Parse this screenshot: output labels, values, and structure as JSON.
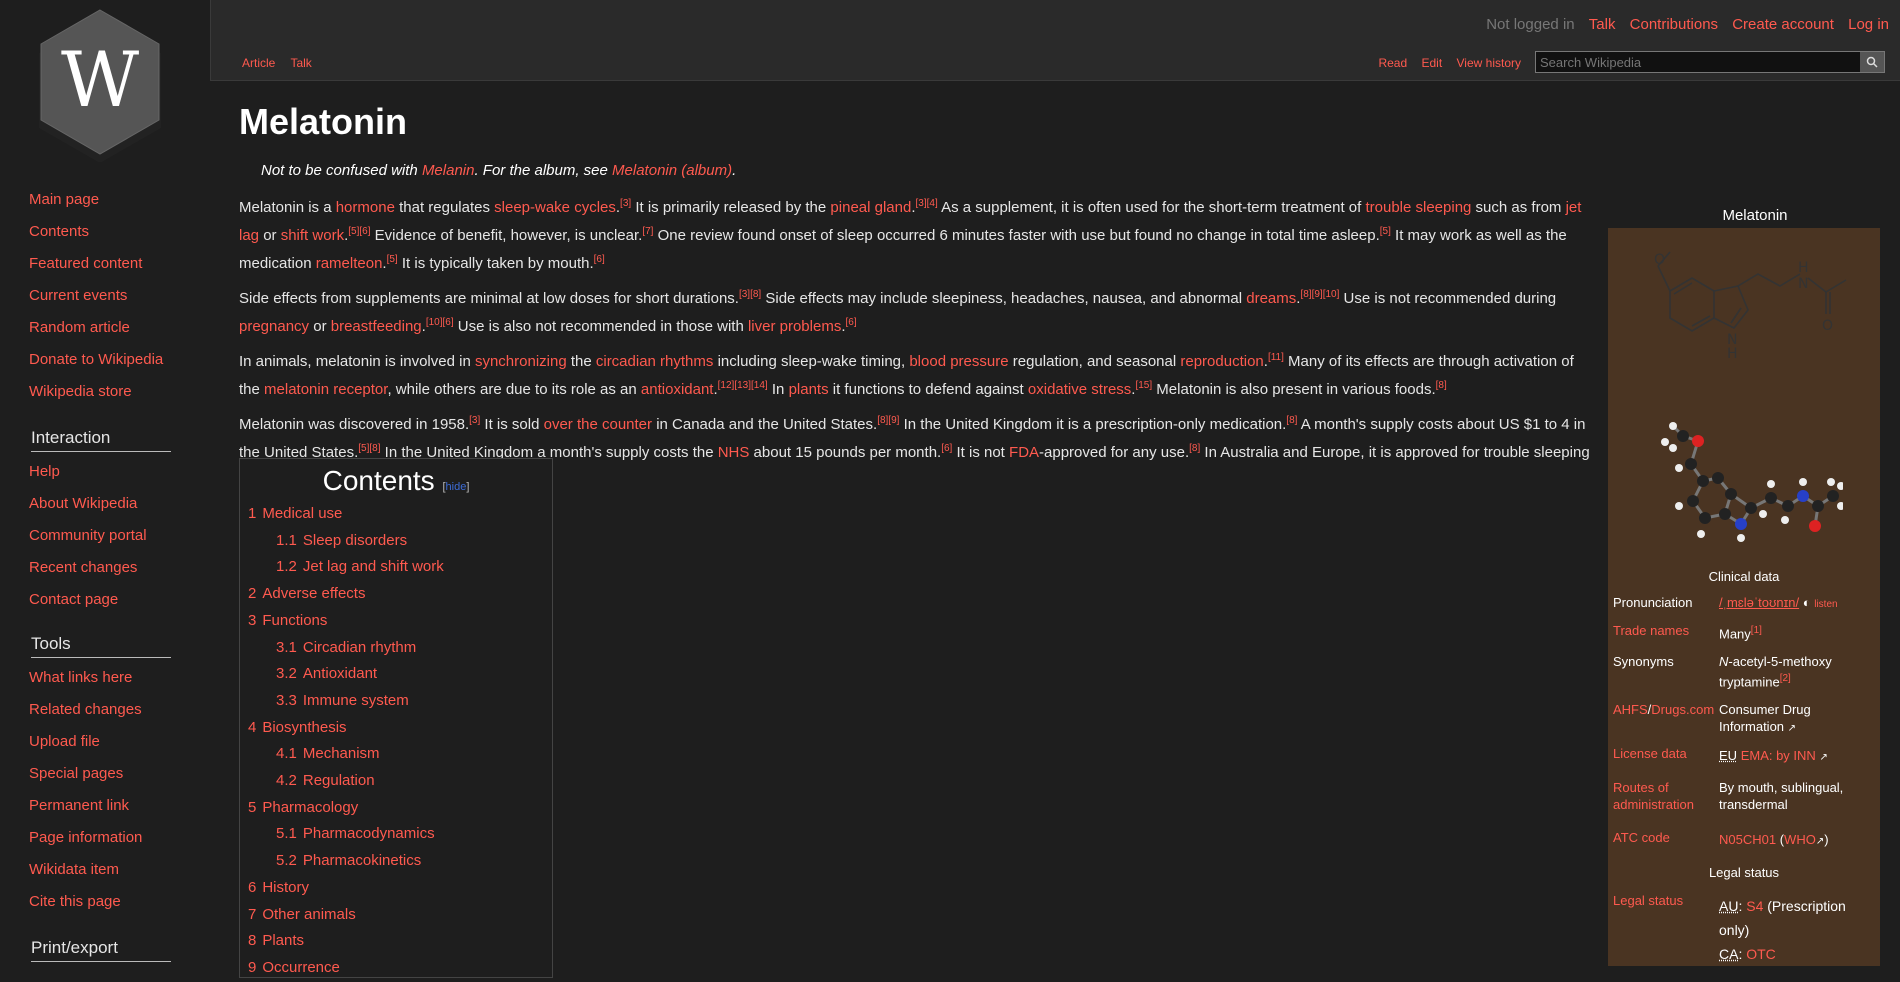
{
  "sidebar": {
    "navigation": [
      "Main page",
      "Contents",
      "Featured content",
      "Current events",
      "Random article",
      "Donate to Wikipedia",
      "Wikipedia store"
    ],
    "interaction_heading": "Interaction",
    "interaction": [
      "Help",
      "About Wikipedia",
      "Community portal",
      "Recent changes",
      "Contact page"
    ],
    "tools_heading": "Tools",
    "tools": [
      "What links here",
      "Related changes",
      "Upload file",
      "Special pages",
      "Permanent link",
      "Page information",
      "Wikidata item",
      "Cite this page"
    ],
    "print_heading": "Print/export"
  },
  "topbar": {
    "not_logged_in": "Not logged in",
    "talk": "Talk",
    "contributions": "Contributions",
    "create_account": "Create account",
    "log_in": "Log in",
    "tab_article": "Article",
    "tab_talk": "Talk",
    "tab_read": "Read",
    "tab_edit": "Edit",
    "tab_history": "View history",
    "search_placeholder": "Search Wikipedia"
  },
  "article": {
    "title": "Melatonin",
    "hatnote": {
      "pre": "Not to be confused with ",
      "link1": "Melanin",
      "mid": ". For the album, see ",
      "link2": "Melatonin (album)",
      "post": "."
    }
  },
  "toc": {
    "title": "Contents",
    "hide_label": "hide",
    "items": [
      {
        "num": "1",
        "label": "Medical use",
        "level": 1
      },
      {
        "num": "1.1",
        "label": "Sleep disorders",
        "level": 2
      },
      {
        "num": "1.2",
        "label": "Jet lag and shift work",
        "level": 2
      },
      {
        "num": "2",
        "label": "Adverse effects",
        "level": 1
      },
      {
        "num": "3",
        "label": "Functions",
        "level": 1
      },
      {
        "num": "3.1",
        "label": "Circadian rhythm",
        "level": 2
      },
      {
        "num": "3.2",
        "label": "Antioxidant",
        "level": 2
      },
      {
        "num": "3.3",
        "label": "Immune system",
        "level": 2
      },
      {
        "num": "4",
        "label": "Biosynthesis",
        "level": 1
      },
      {
        "num": "4.1",
        "label": "Mechanism",
        "level": 2
      },
      {
        "num": "4.2",
        "label": "Regulation",
        "level": 2
      },
      {
        "num": "5",
        "label": "Pharmacology",
        "level": 1
      },
      {
        "num": "5.1",
        "label": "Pharmacodynamics",
        "level": 2
      },
      {
        "num": "5.2",
        "label": "Pharmacokinetics",
        "level": 2
      },
      {
        "num": "6",
        "label": "History",
        "level": 1
      },
      {
        "num": "7",
        "label": "Other animals",
        "level": 1
      },
      {
        "num": "8",
        "label": "Plants",
        "level": 1
      },
      {
        "num": "9",
        "label": "Occurrence",
        "level": 1
      }
    ]
  },
  "infobox": {
    "caption": "Melatonin",
    "clinical_heading": "Clinical data",
    "legal_heading": "Legal status",
    "rows": {
      "pronunciation_label": "Pronunciation",
      "pronunciation_value": "/ˌmɛləˈtoʊnɪn/",
      "listen": "listen",
      "trade_label": "Trade names",
      "trade_value": "Many",
      "trade_ref": "[1]",
      "synonyms_label": "Synonyms",
      "synonyms_n": "N",
      "synonyms_rest": "-acetyl-5-methoxy tryptamine",
      "synonyms_ref": "[2]",
      "ahfs_label_1": "AHFS",
      "ahfs_label_2": "Drugs.com",
      "ahfs_value": "Consumer Drug Information",
      "license_label": "License data",
      "license_eu": "EU",
      "license_value": "EMA: by INN",
      "routes_label": "Routes of administration",
      "routes_value": "By mouth, sublingual, transdermal",
      "atc_label": "ATC code",
      "atc_value": "N05CH01",
      "atc_who": "WHO",
      "legal_label": "Legal status",
      "legal_au": "AU",
      "legal_au_val": "S4",
      "legal_au_note": "(Prescription only)",
      "legal_ca": "CA",
      "legal_ca_val": "OTC"
    }
  },
  "colors": {
    "link": "#ff5a4f",
    "background": "#1e1e1e",
    "infobox": "#4a3422"
  }
}
